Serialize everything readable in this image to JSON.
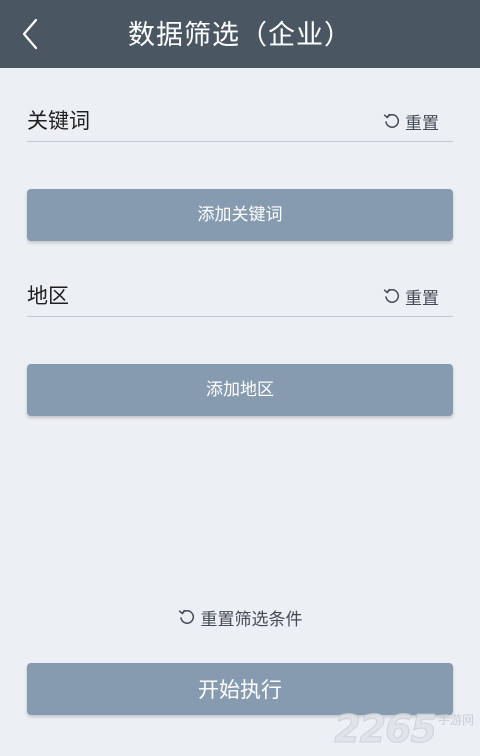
{
  "header": {
    "back_icon": "chevron-left-icon",
    "title": "数据筛选（企业）"
  },
  "keyword_section": {
    "label": "关键词",
    "reset_icon": "refresh-icon",
    "reset_label": "重置",
    "add_button_label": "添加关键词"
  },
  "region_section": {
    "label": "地区",
    "reset_icon": "refresh-icon",
    "reset_label": "重置",
    "add_button_label": "添加地区"
  },
  "reset_all": {
    "icon": "refresh-icon",
    "label": "重置筛选条件"
  },
  "start_button": {
    "label": "开始执行"
  },
  "watermark": {
    "number": "2265",
    "text": "手游网"
  },
  "colors": {
    "header_bg": "#4a5763",
    "page_bg": "#eceff4",
    "button_bg": "#879bb0"
  }
}
